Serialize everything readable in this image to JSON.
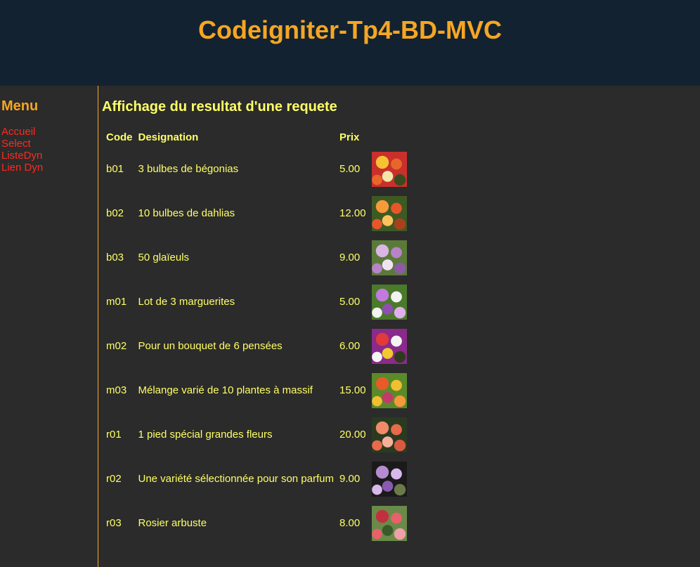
{
  "header": {
    "title": "Codeigniter-Tp4-BD-MVC"
  },
  "sidebar": {
    "title": "Menu",
    "links": [
      "Accueil",
      "Select",
      "ListeDyn",
      "Lien Dyn"
    ]
  },
  "main": {
    "title": "Affichage du resultat d'une requete",
    "columns": {
      "code": "Code",
      "designation": "Designation",
      "prix": "Prix"
    },
    "rows": [
      {
        "code": "b01",
        "designation": "3 bulbes de bégonias",
        "prix": "5.00",
        "image": "begonias-photo"
      },
      {
        "code": "b02",
        "designation": "10 bulbes de dahlias",
        "prix": "12.00",
        "image": "dahlia-photo"
      },
      {
        "code": "b03",
        "designation": "50 glaïeuls",
        "prix": "9.00",
        "image": "glaieuls-photo"
      },
      {
        "code": "m01",
        "designation": "Lot de 3 marguerites",
        "prix": "5.00",
        "image": "marguerites-photo"
      },
      {
        "code": "m02",
        "designation": "Pour un bouquet de 6 pensées",
        "prix": "6.00",
        "image": "pensees-photo"
      },
      {
        "code": "m03",
        "designation": "Mélange varié de 10 plantes à massif",
        "prix": "15.00",
        "image": "massif-photo"
      },
      {
        "code": "r01",
        "designation": "1 pied spécial grandes fleurs",
        "prix": "20.00",
        "image": "rose-orange-photo"
      },
      {
        "code": "r02",
        "designation": "Une variété sélectionnée pour son parfum",
        "prix": "9.00",
        "image": "rose-mauve-photo"
      },
      {
        "code": "r03",
        "designation": "Rosier arbuste",
        "prix": "8.00",
        "image": "rosier-photo"
      }
    ]
  },
  "colors": {
    "header_bg": "#132230",
    "page_bg": "#2b2b2b",
    "accent_orange": "#f5a623",
    "link_red": "#ff2a1f",
    "text_yellow": "#ffff66"
  }
}
